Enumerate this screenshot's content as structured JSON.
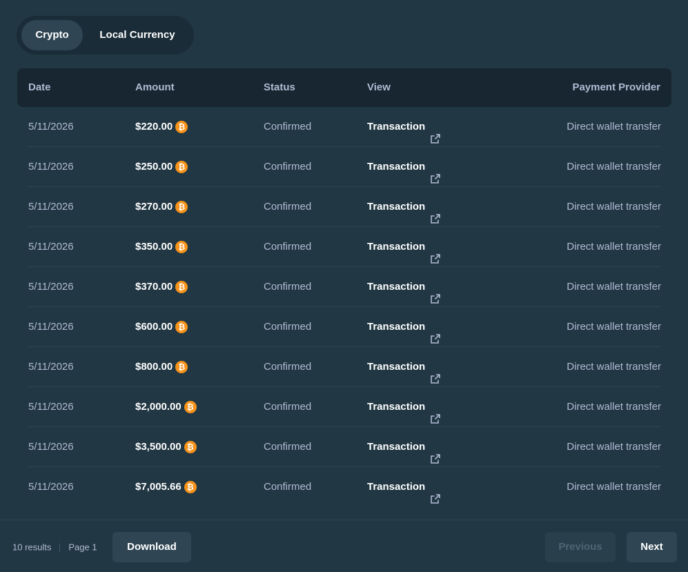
{
  "toggle": {
    "crypto_label": "Crypto",
    "local_label": "Local Currency",
    "selected": "Crypto"
  },
  "table": {
    "headers": {
      "date": "Date",
      "amount": "Amount",
      "status": "Status",
      "view": "View",
      "provider": "Payment Provider"
    },
    "rows": [
      {
        "date": "5/11/2026",
        "amount": "$220.00",
        "status": "Confirmed",
        "view": "Transaction",
        "provider": "Direct wallet transfer"
      },
      {
        "date": "5/11/2026",
        "amount": "$250.00",
        "status": "Confirmed",
        "view": "Transaction",
        "provider": "Direct wallet transfer"
      },
      {
        "date": "5/11/2026",
        "amount": "$270.00",
        "status": "Confirmed",
        "view": "Transaction",
        "provider": "Direct wallet transfer"
      },
      {
        "date": "5/11/2026",
        "amount": "$350.00",
        "status": "Confirmed",
        "view": "Transaction",
        "provider": "Direct wallet transfer"
      },
      {
        "date": "5/11/2026",
        "amount": "$370.00",
        "status": "Confirmed",
        "view": "Transaction",
        "provider": "Direct wallet transfer"
      },
      {
        "date": "5/11/2026",
        "amount": "$600.00",
        "status": "Confirmed",
        "view": "Transaction",
        "provider": "Direct wallet transfer"
      },
      {
        "date": "5/11/2026",
        "amount": "$800.00",
        "status": "Confirmed",
        "view": "Transaction",
        "provider": "Direct wallet transfer"
      },
      {
        "date": "5/11/2026",
        "amount": "$2,000.00",
        "status": "Confirmed",
        "view": "Transaction",
        "provider": "Direct wallet transfer"
      },
      {
        "date": "5/11/2026",
        "amount": "$3,500.00",
        "status": "Confirmed",
        "view": "Transaction",
        "provider": "Direct wallet transfer"
      },
      {
        "date": "5/11/2026",
        "amount": "$7,005.66",
        "status": "Confirmed",
        "view": "Transaction",
        "provider": "Direct wallet transfer"
      }
    ],
    "currency_icon": "bitcoin-icon",
    "view_icon": "external-link-icon"
  },
  "footer": {
    "results": "10 results",
    "page": "Page 1",
    "download_label": "Download",
    "previous_label": "Previous",
    "next_label": "Next"
  },
  "colors": {
    "background": "#213743",
    "header_bg": "#172630",
    "button_bg": "#2f4553",
    "muted_text": "#b1bad3",
    "bitcoin": "#f7931a"
  }
}
